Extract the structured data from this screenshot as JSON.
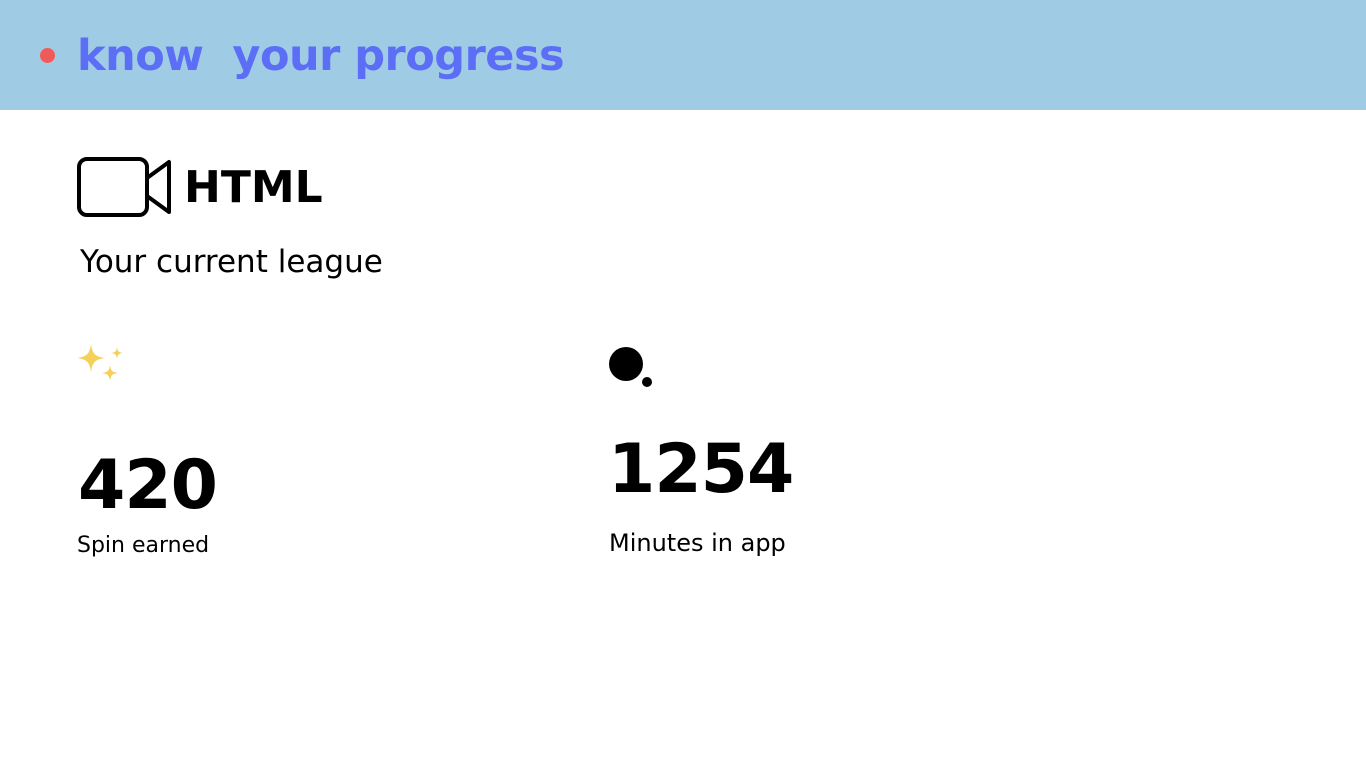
{
  "header": {
    "title": "know  your progress",
    "background_color": "#9fcce4",
    "title_color": "#5b6ef5",
    "bullet_color": "#f25a5a"
  },
  "course": {
    "icon": "video-camera-icon",
    "name": "HTML"
  },
  "league": {
    "label": "Your current league"
  },
  "stats": {
    "spin": {
      "icon": "sparkles-icon",
      "value": "420",
      "label": "Spin earned",
      "icon_color": "#f5d15a"
    },
    "minutes": {
      "icon": "moon-icon",
      "value": "1254",
      "label": "Minutes in app"
    }
  }
}
